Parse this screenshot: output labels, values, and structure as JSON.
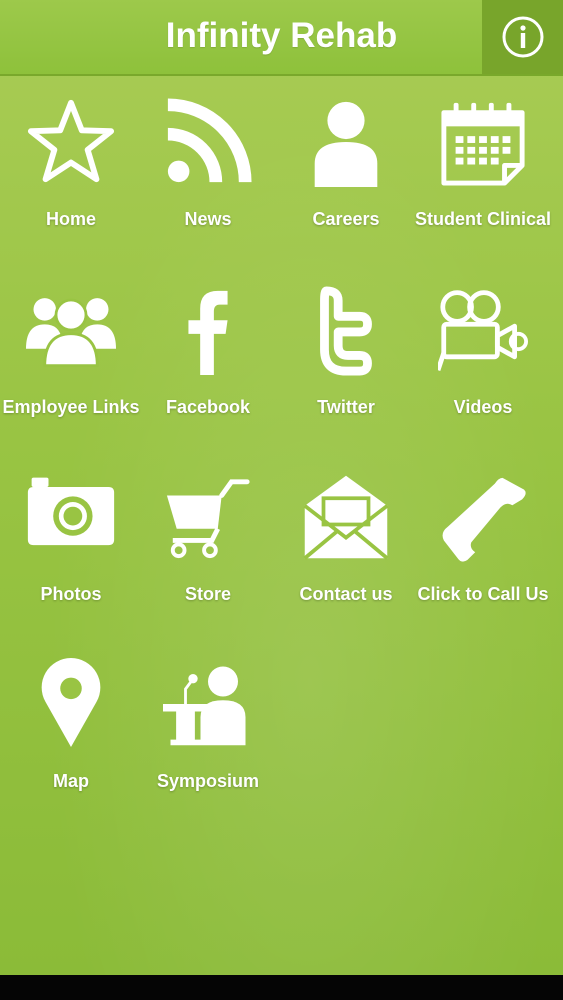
{
  "header": {
    "title": "Infinity Rehab",
    "info_icon": "info-circle-icon"
  },
  "colors": {
    "background": "#99c443",
    "header": "#8ec13b",
    "info_button": "#78a52b",
    "text": "#ffffff"
  },
  "tiles": [
    {
      "label": "Home",
      "icon": "star-icon"
    },
    {
      "label": "News",
      "icon": "rss-icon"
    },
    {
      "label": "Careers",
      "icon": "person-icon"
    },
    {
      "label": "Student Clinical",
      "icon": "calendar-icon"
    },
    {
      "label": "Employee Links",
      "icon": "group-icon"
    },
    {
      "label": "Facebook",
      "icon": "facebook-icon"
    },
    {
      "label": "Twitter",
      "icon": "twitter-icon"
    },
    {
      "label": "Videos",
      "icon": "video-camera-icon"
    },
    {
      "label": "Photos",
      "icon": "camera-icon"
    },
    {
      "label": "Store",
      "icon": "shopping-cart-icon"
    },
    {
      "label": "Contact us",
      "icon": "envelope-icon"
    },
    {
      "label": "Click to Call Us",
      "icon": "phone-icon"
    },
    {
      "label": "Map",
      "icon": "map-pin-icon"
    },
    {
      "label": "Symposium",
      "icon": "speaker-podium-icon"
    }
  ]
}
